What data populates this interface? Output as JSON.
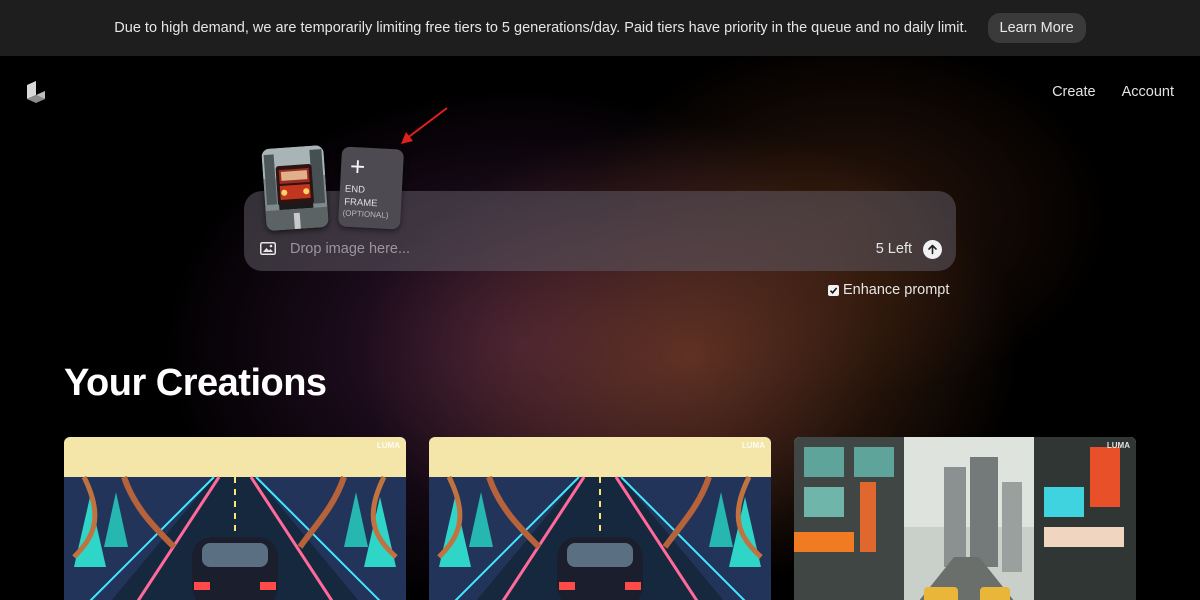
{
  "banner": {
    "text": "Due to high demand, we are temporarily limiting free tiers to 5 generations/day. Paid tiers have priority in the queue and no daily limit.",
    "learn_more": "Learn More"
  },
  "nav": {
    "create": "Create",
    "account": "Account"
  },
  "prompt": {
    "placeholder": "Drop image here...",
    "remaining": "5 Left",
    "end_frame_label": "END FRAME",
    "end_frame_optional": "(OPTIONAL)"
  },
  "enhance": {
    "label": "Enhance prompt",
    "checked": true
  },
  "creations": {
    "title": "Your Creations",
    "cards": [
      {
        "watermark": "LUMA"
      },
      {
        "watermark": "LUMA"
      },
      {
        "watermark": "LUMA"
      }
    ]
  },
  "colors": {
    "banner_bg": "#1e1e1e",
    "annotation_arrow": "#e0201a"
  }
}
